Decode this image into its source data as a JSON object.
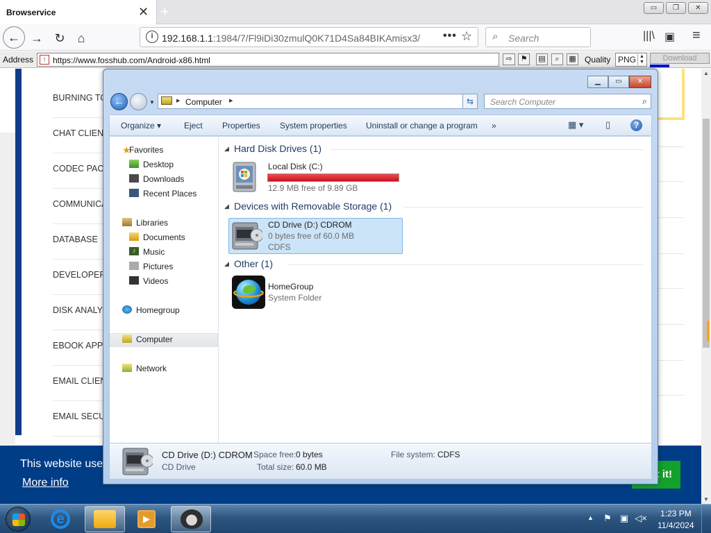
{
  "browser": {
    "tab_title": "Browservice",
    "close_glyph": "✕",
    "newtab_glyph": "+",
    "window_buttons": [
      "▭",
      "❐",
      "✕"
    ],
    "nav": {
      "back": "←",
      "forward": "→",
      "reload": "↻",
      "home": "⌂"
    },
    "url_prefix": "192.168.1.1",
    "url_rest": ":1984/7/Fl9iDi30zmulQ0K71D4Sa84BIKAmisx3/",
    "url_menu": "•••",
    "bookmark_star": "☆",
    "search_placeholder": "Search",
    "library_icon": "|||\\",
    "sidebar_icon": "▣",
    "menu_icon": "≡"
  },
  "addressbar": {
    "label": "Address",
    "url": "https://www.fosshub.com/Android-x86.html",
    "go_glyph": "⇨",
    "quality_label": "Quality",
    "quality_value": "PNG",
    "download_label": "Download"
  },
  "webpage": {
    "categories": [
      "BURNING TO",
      "CHAT CLIEN",
      "CODEC PACI",
      "COMMUNICA",
      "DATABASE",
      "DEVELOPER",
      "DISK ANALY",
      "EBOOK APPS",
      "EMAIL CLIEN",
      "EMAIL SECU"
    ],
    "cookie_message": "This website use",
    "cookie_more": "More info",
    "cookie_button": "t it!"
  },
  "explorer": {
    "breadcrumb": "Computer",
    "search_placeholder": "Search Computer",
    "commands": [
      "Organize",
      "Eject",
      "Properties",
      "System properties",
      "Uninstall or change a program",
      "»"
    ],
    "nav": {
      "favorites": "Favorites",
      "desktop": "Desktop",
      "downloads": "Downloads",
      "recent": "Recent Places",
      "libraries": "Libraries",
      "documents": "Documents",
      "music": "Music",
      "pictures": "Pictures",
      "videos": "Videos",
      "homegroup": "Homegroup",
      "computer": "Computer",
      "network": "Network"
    },
    "groups": {
      "hdd": "Hard Disk Drives (1)",
      "removable": "Devices with Removable Storage (1)",
      "other": "Other (1)"
    },
    "local_disk": {
      "name": "Local Disk (C:)",
      "free": "12.9 MB free of 9.89 GB",
      "used_fraction": 0.999
    },
    "cd_drive": {
      "name": "CD Drive (D:) CDROM",
      "free": "0 bytes free of 60.0 MB",
      "fs": "CDFS"
    },
    "homegroup_item": {
      "name": "HomeGroup",
      "type": "System Folder"
    },
    "details": {
      "name": "CD Drive (D:) CDROM",
      "type": "CD Drive",
      "space_free_label": "Space free:",
      "space_free": "0 bytes",
      "total_size_label": "Total size:",
      "total_size": "60.0 MB",
      "fs_label": "File system:",
      "fs": "CDFS"
    }
  },
  "taskbar": {
    "time": "1:23 PM",
    "date": "11/4/2024"
  },
  "colors": {
    "accent_blue": "#003d87",
    "disk_full_red": "#c9111b",
    "got_it_green": "#12a12b"
  }
}
